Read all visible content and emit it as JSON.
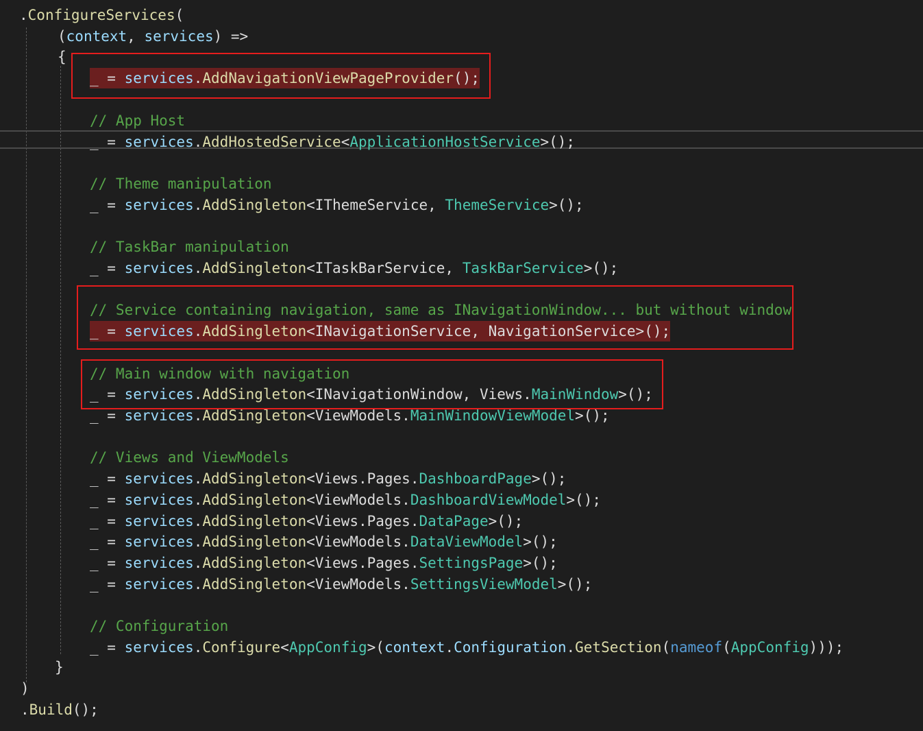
{
  "code_lines": [
    {
      "tokens": [
        {
          "c": "plain",
          "t": "."
        },
        {
          "c": "method",
          "t": "ConfigureServices"
        },
        {
          "c": "plain",
          "t": "("
        }
      ]
    },
    {
      "tokens": [
        {
          "c": "plain",
          "t": "("
        },
        {
          "c": "var",
          "t": "context"
        },
        {
          "c": "plain",
          "t": ", "
        },
        {
          "c": "var",
          "t": "services"
        },
        {
          "c": "plain",
          "t": ") =>"
        }
      ]
    },
    {
      "tokens": [
        {
          "c": "plain",
          "t": "{"
        }
      ]
    },
    {
      "highlighted": true,
      "tokens": [
        {
          "c": "plain",
          "t": "_ = "
        },
        {
          "c": "var",
          "t": "services"
        },
        {
          "c": "plain",
          "t": "."
        },
        {
          "c": "method",
          "t": "AddNavigationViewPageProvider"
        },
        {
          "c": "plain",
          "t": "();"
        }
      ]
    },
    {
      "tokens": [
        {
          "c": "comment",
          "t": "// App Host"
        }
      ]
    },
    {
      "tokens": [
        {
          "c": "plain",
          "t": "_ = "
        },
        {
          "c": "var",
          "t": "services"
        },
        {
          "c": "plain",
          "t": "."
        },
        {
          "c": "method",
          "t": "AddHostedService"
        },
        {
          "c": "plain",
          "t": "<"
        },
        {
          "c": "type",
          "t": "ApplicationHostService"
        },
        {
          "c": "plain",
          "t": ">();"
        }
      ]
    },
    {
      "tokens": [
        {
          "c": "comment",
          "t": "// Theme manipulation"
        }
      ]
    },
    {
      "tokens": [
        {
          "c": "plain",
          "t": "_ = "
        },
        {
          "c": "var",
          "t": "services"
        },
        {
          "c": "plain",
          "t": "."
        },
        {
          "c": "method",
          "t": "AddSingleton"
        },
        {
          "c": "plain",
          "t": "<IThemeService, "
        },
        {
          "c": "type",
          "t": "ThemeService"
        },
        {
          "c": "plain",
          "t": ">();"
        }
      ]
    },
    {
      "tokens": [
        {
          "c": "comment",
          "t": "// TaskBar manipulation"
        }
      ]
    },
    {
      "tokens": [
        {
          "c": "plain",
          "t": "_ = "
        },
        {
          "c": "var",
          "t": "services"
        },
        {
          "c": "plain",
          "t": "."
        },
        {
          "c": "method",
          "t": "AddSingleton"
        },
        {
          "c": "plain",
          "t": "<ITaskBarService, "
        },
        {
          "c": "type",
          "t": "TaskBarService"
        },
        {
          "c": "plain",
          "t": ">();"
        }
      ]
    },
    {
      "tokens": [
        {
          "c": "comment",
          "t": "// Service containing navigation, same as INavigationWindow... but without window"
        }
      ]
    },
    {
      "highlighted": true,
      "tokens": [
        {
          "c": "plain",
          "t": "_ = "
        },
        {
          "c": "var",
          "t": "services"
        },
        {
          "c": "plain",
          "t": "."
        },
        {
          "c": "method",
          "t": "AddSingleton"
        },
        {
          "c": "plain",
          "t": "<INavigationService, NavigationService>();"
        }
      ]
    },
    {
      "tokens": [
        {
          "c": "comment",
          "t": "// Main window with navigation"
        }
      ]
    },
    {
      "tokens": [
        {
          "c": "plain",
          "t": "_ = "
        },
        {
          "c": "var",
          "t": "services"
        },
        {
          "c": "plain",
          "t": "."
        },
        {
          "c": "method",
          "t": "AddSingleton"
        },
        {
          "c": "plain",
          "t": "<INavigationWindow, Views."
        },
        {
          "c": "type",
          "t": "MainWindow"
        },
        {
          "c": "plain",
          "t": ">();"
        }
      ]
    },
    {
      "tokens": [
        {
          "c": "plain",
          "t": "_ = "
        },
        {
          "c": "var",
          "t": "services"
        },
        {
          "c": "plain",
          "t": "."
        },
        {
          "c": "method",
          "t": "AddSingleton"
        },
        {
          "c": "plain",
          "t": "<ViewModels."
        },
        {
          "c": "type",
          "t": "MainWindowViewModel"
        },
        {
          "c": "plain",
          "t": ">();"
        }
      ]
    },
    {
      "tokens": [
        {
          "c": "comment",
          "t": "// Views and ViewModels"
        }
      ]
    },
    {
      "tokens": [
        {
          "c": "plain",
          "t": "_ = "
        },
        {
          "c": "var",
          "t": "services"
        },
        {
          "c": "plain",
          "t": "."
        },
        {
          "c": "method",
          "t": "AddSingleton"
        },
        {
          "c": "plain",
          "t": "<Views.Pages."
        },
        {
          "c": "type",
          "t": "DashboardPage"
        },
        {
          "c": "plain",
          "t": ">();"
        }
      ]
    },
    {
      "tokens": [
        {
          "c": "plain",
          "t": "_ = "
        },
        {
          "c": "var",
          "t": "services"
        },
        {
          "c": "plain",
          "t": "."
        },
        {
          "c": "method",
          "t": "AddSingleton"
        },
        {
          "c": "plain",
          "t": "<ViewModels."
        },
        {
          "c": "type",
          "t": "DashboardViewModel"
        },
        {
          "c": "plain",
          "t": ">();"
        }
      ]
    },
    {
      "tokens": [
        {
          "c": "plain",
          "t": "_ = "
        },
        {
          "c": "var",
          "t": "services"
        },
        {
          "c": "plain",
          "t": "."
        },
        {
          "c": "method",
          "t": "AddSingleton"
        },
        {
          "c": "plain",
          "t": "<Views.Pages."
        },
        {
          "c": "type",
          "t": "DataPage"
        },
        {
          "c": "plain",
          "t": ">();"
        }
      ]
    },
    {
      "tokens": [
        {
          "c": "plain",
          "t": "_ = "
        },
        {
          "c": "var",
          "t": "services"
        },
        {
          "c": "plain",
          "t": "."
        },
        {
          "c": "method",
          "t": "AddSingleton"
        },
        {
          "c": "plain",
          "t": "<ViewModels."
        },
        {
          "c": "type",
          "t": "DataViewModel"
        },
        {
          "c": "plain",
          "t": ">();"
        }
      ]
    },
    {
      "tokens": [
        {
          "c": "plain",
          "t": "_ = "
        },
        {
          "c": "var",
          "t": "services"
        },
        {
          "c": "plain",
          "t": "."
        },
        {
          "c": "method",
          "t": "AddSingleton"
        },
        {
          "c": "plain",
          "t": "<Views.Pages."
        },
        {
          "c": "type",
          "t": "SettingsPage"
        },
        {
          "c": "plain",
          "t": ">();"
        }
      ]
    },
    {
      "tokens": [
        {
          "c": "plain",
          "t": "_ = "
        },
        {
          "c": "var",
          "t": "services"
        },
        {
          "c": "plain",
          "t": "."
        },
        {
          "c": "method",
          "t": "AddSingleton"
        },
        {
          "c": "plain",
          "t": "<ViewModels."
        },
        {
          "c": "type",
          "t": "SettingsViewModel"
        },
        {
          "c": "plain",
          "t": ">();"
        }
      ]
    },
    {
      "tokens": [
        {
          "c": "comment",
          "t": "// Configuration"
        }
      ]
    },
    {
      "tokens": [
        {
          "c": "plain",
          "t": "_ = "
        },
        {
          "c": "var",
          "t": "services"
        },
        {
          "c": "plain",
          "t": "."
        },
        {
          "c": "method",
          "t": "Configure"
        },
        {
          "c": "plain",
          "t": "<"
        },
        {
          "c": "type",
          "t": "AppConfig"
        },
        {
          "c": "plain",
          "t": ">("
        },
        {
          "c": "var",
          "t": "context"
        },
        {
          "c": "plain",
          "t": "."
        },
        {
          "c": "var",
          "t": "Configuration"
        },
        {
          "c": "plain",
          "t": "."
        },
        {
          "c": "method",
          "t": "GetSection"
        },
        {
          "c": "plain",
          "t": "("
        },
        {
          "c": "kw",
          "t": "nameof"
        },
        {
          "c": "plain",
          "t": "("
        },
        {
          "c": "type",
          "t": "AppConfig"
        },
        {
          "c": "plain",
          "t": ")));"
        }
      ]
    },
    {
      "tokens": [
        {
          "c": "plain",
          "t": "}"
        }
      ]
    },
    {
      "tokens": [
        {
          "c": "plain",
          "t": ")"
        }
      ]
    },
    {
      "tokens": [
        {
          "c": "plain",
          "t": "."
        },
        {
          "c": "method",
          "t": "Build"
        },
        {
          "c": "plain",
          "t": "();"
        }
      ]
    }
  ],
  "colors": {
    "background": "#1e1e1e",
    "highlight": "#6b1f1f",
    "annotation_box": "#e51d1d"
  }
}
